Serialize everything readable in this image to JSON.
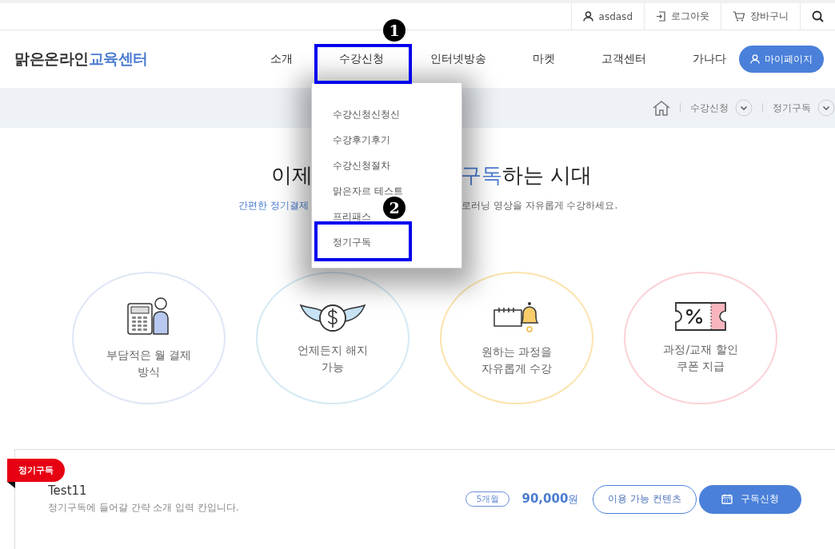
{
  "top_bar": {
    "user": "asdasd",
    "logout": "로그아웃",
    "cart": "장바구니"
  },
  "header": {
    "logo_main": "맑은온라인",
    "logo_accent": "교육센터",
    "nav": [
      {
        "label": "소개"
      },
      {
        "label": "수강신청"
      },
      {
        "label": "인터넷방송"
      },
      {
        "label": "마켓"
      },
      {
        "label": "고객센터"
      },
      {
        "label": "가나다"
      }
    ],
    "mypage": "마이페이지"
  },
  "dropdown": {
    "items": [
      {
        "label": "수강신청신청신"
      },
      {
        "label": "수강후기후기"
      },
      {
        "label": "수강신청절차"
      },
      {
        "label": "맑은자르 테스트"
      },
      {
        "label": "프리패스"
      },
      {
        "label": "정기구독"
      }
    ]
  },
  "annotations": [
    {
      "label": "1"
    },
    {
      "label": "2"
    }
  ],
  "breadcrumb": [
    {
      "label": "수강신청"
    },
    {
      "label": "정기구독"
    }
  ],
  "hero": {
    "headline_left": "이제",
    "headline_highlight": "구독",
    "headline_rest": "하는 시대",
    "subtitle_left": "간편한 정기결제",
    "subtitle_right": "로러닝 영상을 자유롭게 수강하세요."
  },
  "features": [
    {
      "kind": "calculator",
      "color": "#dfe6f6",
      "lines": [
        "부담적은 월 결제",
        "방식"
      ]
    },
    {
      "kind": "money",
      "color": "#d5e9f4",
      "lines": [
        "언제든지 해지",
        "가능"
      ]
    },
    {
      "kind": "bell",
      "color": "#fbe4ae",
      "lines": [
        "원하는 과정을",
        "자유롭게 수강"
      ]
    },
    {
      "kind": "coupon",
      "color": "#fbd2d7",
      "lines": [
        "과정/교재 할인",
        "쿠폰 지급"
      ]
    }
  ],
  "product": {
    "badge": "정기구독",
    "title": "Test11",
    "description": "정기구독에 들어갈 간략 소개 입력 칸입니다.",
    "period": "5개월",
    "price": "90,000",
    "currency": "원",
    "contents_button": "이용 가능 컨텐츠",
    "subscribe_button": "구독신청"
  }
}
